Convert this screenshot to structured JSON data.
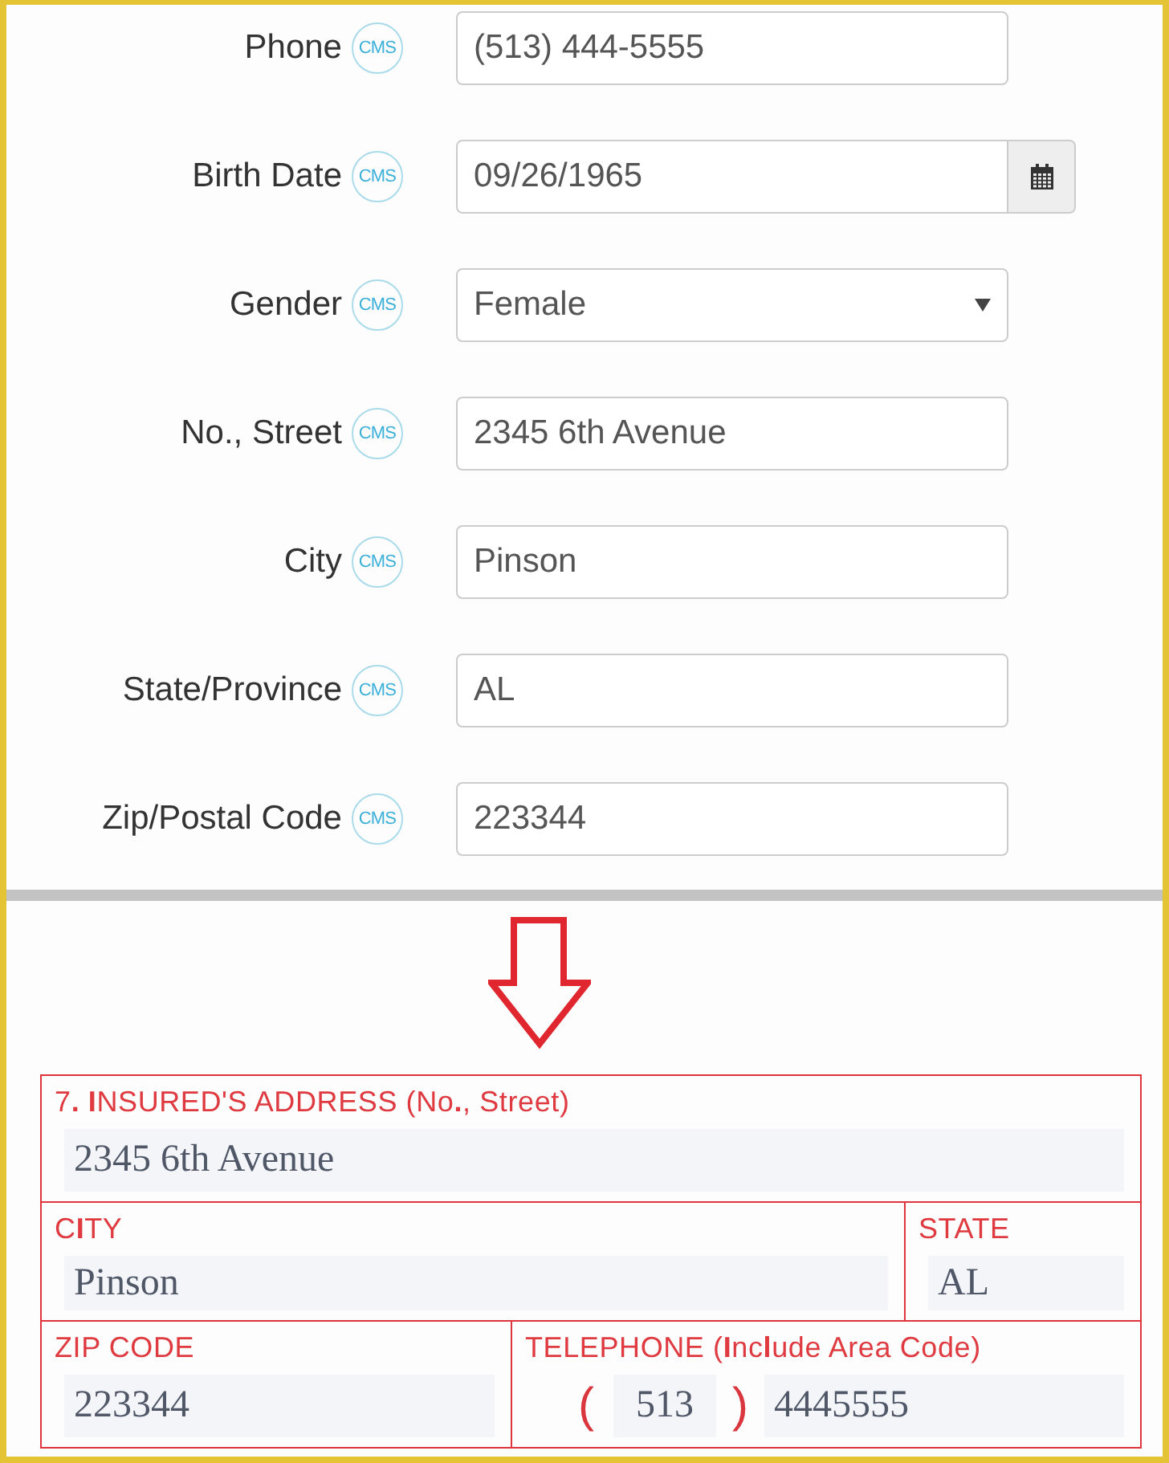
{
  "contact_form": {
    "fields": [
      {
        "label": "Phone",
        "badge": "CMS",
        "kind": "text",
        "value": "(513) 444-5555"
      },
      {
        "label": "Birth Date",
        "badge": "CMS",
        "kind": "date",
        "value": "09/26/1965"
      },
      {
        "label": "Gender",
        "badge": "CMS",
        "kind": "select",
        "value": "Female"
      },
      {
        "label": "No., Street",
        "badge": "CMS",
        "kind": "text",
        "value": "2345 6th Avenue"
      },
      {
        "label": "City",
        "badge": "CMS",
        "kind": "text",
        "value": "Pinson"
      },
      {
        "label": "State/Province",
        "badge": "CMS",
        "kind": "text",
        "value": "AL"
      },
      {
        "label": "Zip/Postal Code",
        "badge": "CMS",
        "kind": "text",
        "value": "223344"
      }
    ]
  },
  "claim_form": {
    "rows": [
      {
        "cells": [
          {
            "kind": "text",
            "label": "7**. I**NSURED'S ADDRESS (No**.**, Street)",
            "value": "2345 6th Avenue"
          }
        ]
      },
      {
        "cells": [
          {
            "kind": "text",
            "label": "C**I**TY",
            "value": "Pinson"
          },
          {
            "kind": "text",
            "label": "STATE",
            "value": "AL"
          }
        ]
      },
      {
        "cells": [
          {
            "kind": "text",
            "label": "ZIP CODE",
            "value": "223344"
          },
          {
            "kind": "phone",
            "label": "TELEPHONE (**I**nc**l**ude Area Code)",
            "open_paren": "(",
            "area_code": "513",
            "close_paren": ")",
            "number": "4445555"
          }
        ]
      }
    ]
  }
}
